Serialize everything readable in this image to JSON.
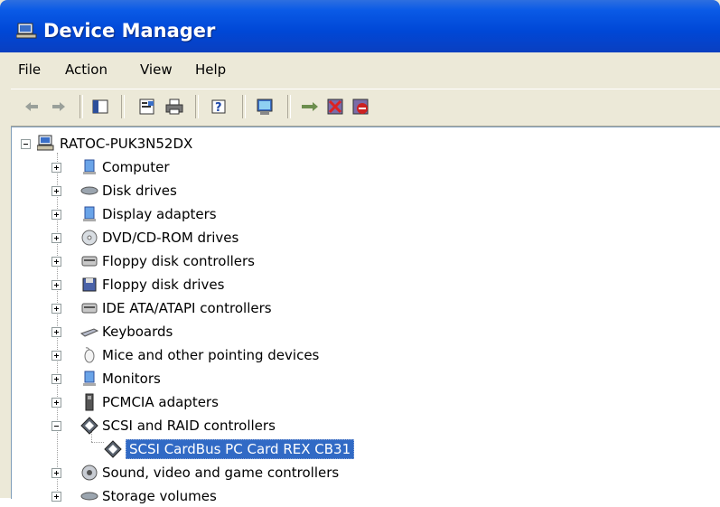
{
  "window": {
    "title": "Device Manager"
  },
  "menu": {
    "file": "File",
    "action": "Action",
    "view": "View",
    "help": "Help"
  },
  "toolbar": {
    "icons": [
      "back-arrow-icon",
      "forward-arrow-icon",
      "show-hide-console-tree-icon",
      "properties-icon",
      "print-icon",
      "help-icon",
      "scan-hardware-icon",
      "update-driver-icon",
      "uninstall-icon",
      "disable-icon"
    ]
  },
  "tree": {
    "root": "RATOC-PUK3N52DX",
    "items": [
      {
        "label": "Computer",
        "icon": "computer-icon",
        "expanded": false
      },
      {
        "label": "Disk drives",
        "icon": "disk-drive-icon",
        "expanded": false
      },
      {
        "label": "Display adapters",
        "icon": "display-adapter-icon",
        "expanded": false
      },
      {
        "label": "DVD/CD-ROM drives",
        "icon": "cd-rom-icon",
        "expanded": false
      },
      {
        "label": "Floppy disk controllers",
        "icon": "controller-icon",
        "expanded": false
      },
      {
        "label": "Floppy disk drives",
        "icon": "floppy-icon",
        "expanded": false
      },
      {
        "label": "IDE ATA/ATAPI controllers",
        "icon": "controller-icon",
        "expanded": false
      },
      {
        "label": "Keyboards",
        "icon": "keyboard-icon",
        "expanded": false
      },
      {
        "label": "Mice and other pointing devices",
        "icon": "mouse-icon",
        "expanded": false
      },
      {
        "label": "Monitors",
        "icon": "monitor-icon",
        "expanded": false
      },
      {
        "label": "PCMCIA adapters",
        "icon": "pcmcia-icon",
        "expanded": false
      },
      {
        "label": "SCSI and RAID controllers",
        "icon": "scsi-icon",
        "expanded": true
      },
      {
        "label": "Sound, video and game controllers",
        "icon": "sound-icon",
        "expanded": false
      },
      {
        "label": "Storage volumes",
        "icon": "storage-icon",
        "expanded": false
      }
    ],
    "child": {
      "label": "SCSI CardBus PC Card REX CB31",
      "icon": "scsi-icon",
      "selected": true
    }
  }
}
